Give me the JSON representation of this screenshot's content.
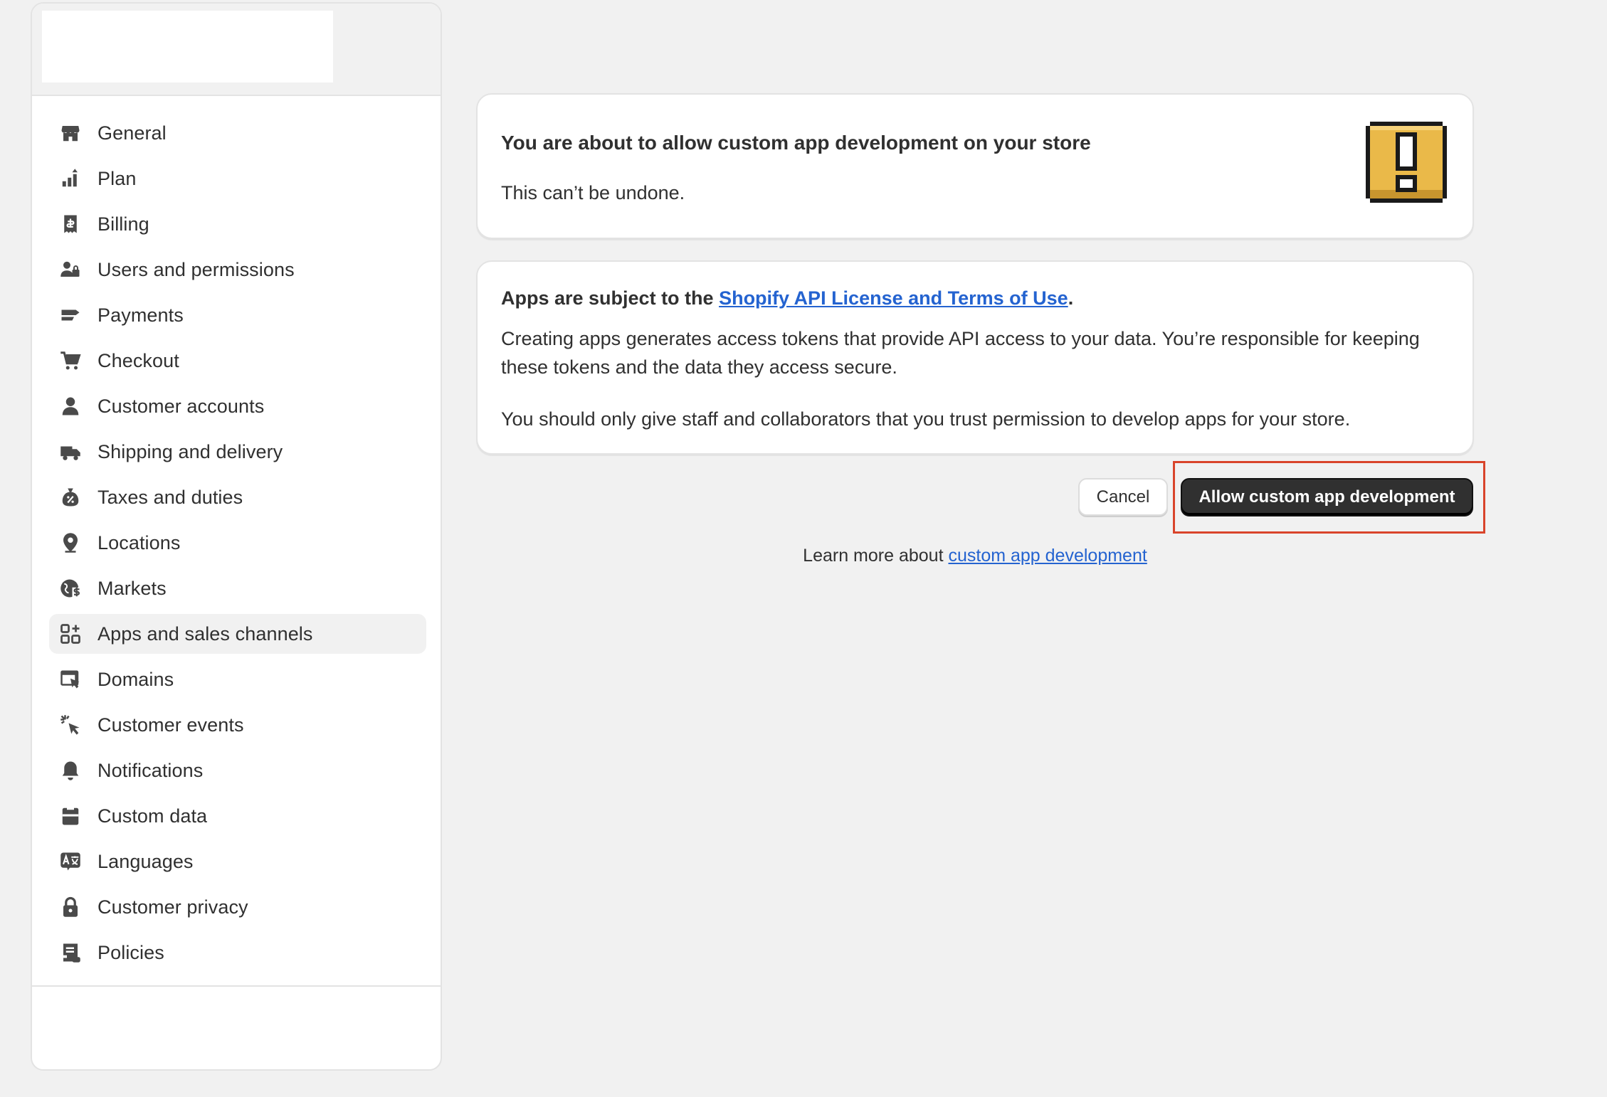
{
  "sidebar": {
    "items": [
      {
        "label": "General",
        "icon": "store-icon"
      },
      {
        "label": "Plan",
        "icon": "plan-icon"
      },
      {
        "label": "Billing",
        "icon": "billing-icon"
      },
      {
        "label": "Users and permissions",
        "icon": "users-icon"
      },
      {
        "label": "Payments",
        "icon": "payments-icon"
      },
      {
        "label": "Checkout",
        "icon": "cart-icon"
      },
      {
        "label": "Customer accounts",
        "icon": "person-icon"
      },
      {
        "label": "Shipping and delivery",
        "icon": "truck-icon"
      },
      {
        "label": "Taxes and duties",
        "icon": "tax-icon"
      },
      {
        "label": "Locations",
        "icon": "location-icon"
      },
      {
        "label": "Markets",
        "icon": "globe-icon"
      },
      {
        "label": "Apps and sales channels",
        "icon": "apps-icon",
        "active": true
      },
      {
        "label": "Domains",
        "icon": "domains-icon"
      },
      {
        "label": "Customer events",
        "icon": "cursor-icon"
      },
      {
        "label": "Notifications",
        "icon": "bell-icon"
      },
      {
        "label": "Custom data",
        "icon": "custom-data-icon"
      },
      {
        "label": "Languages",
        "icon": "language-icon"
      },
      {
        "label": "Customer privacy",
        "icon": "lock-icon"
      },
      {
        "label": "Policies",
        "icon": "policies-icon"
      }
    ]
  },
  "warning_card": {
    "title": "You are about to allow custom app development on your store",
    "subtitle": "This can’t be undone.",
    "icon": "warning-exclamation-icon",
    "icon_color": "#eab949"
  },
  "terms_card": {
    "title_prefix": "Apps are subject to the ",
    "title_link": "Shopify API License and Terms of Use",
    "title_suffix": ".",
    "paragraph1": "Creating apps generates access tokens that provide API access to your data. You’re responsible for keeping these tokens and the data they access secure.",
    "paragraph2": "You should only give staff and collaborators that you trust permission to develop apps for your store."
  },
  "actions": {
    "cancel_label": "Cancel",
    "allow_label": "Allow custom app development",
    "highlight_color": "#d9442b"
  },
  "footer": {
    "learn_prefix": "Learn more about ",
    "learn_link": "custom app development"
  }
}
